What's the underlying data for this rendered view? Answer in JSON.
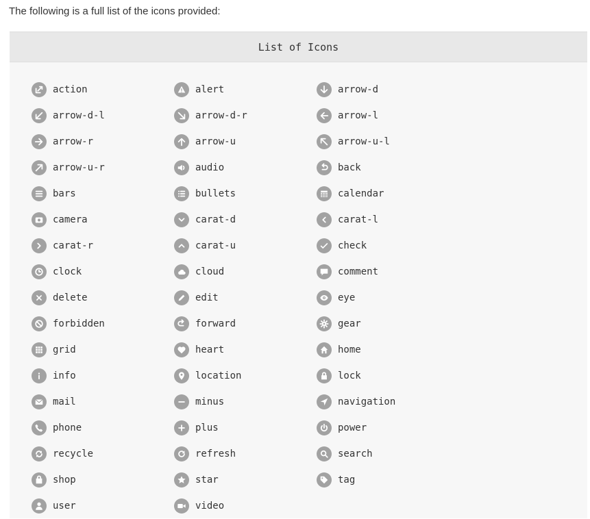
{
  "intro": "The following is a full list of the icons provided:",
  "table": {
    "header": "List of Icons",
    "icons": [
      "action",
      "alert",
      "arrow-d",
      "arrow-d-l",
      "arrow-d-r",
      "arrow-l",
      "arrow-r",
      "arrow-u",
      "arrow-u-l",
      "arrow-u-r",
      "audio",
      "back",
      "bars",
      "bullets",
      "calendar",
      "camera",
      "carat-d",
      "carat-l",
      "carat-r",
      "carat-u",
      "check",
      "clock",
      "cloud",
      "comment",
      "delete",
      "edit",
      "eye",
      "forbidden",
      "forward",
      "gear",
      "grid",
      "heart",
      "home",
      "info",
      "location",
      "lock",
      "mail",
      "minus",
      "navigation",
      "phone",
      "plus",
      "power",
      "recycle",
      "refresh",
      "search",
      "shop",
      "star",
      "tag",
      "user",
      "video"
    ]
  },
  "colors": {
    "icon_bg": "#a2a2a2",
    "icon_fg": "#ffffff",
    "panel_bg": "#f7f7f7",
    "header_bg": "#e8e8e8",
    "text": "#333333"
  }
}
